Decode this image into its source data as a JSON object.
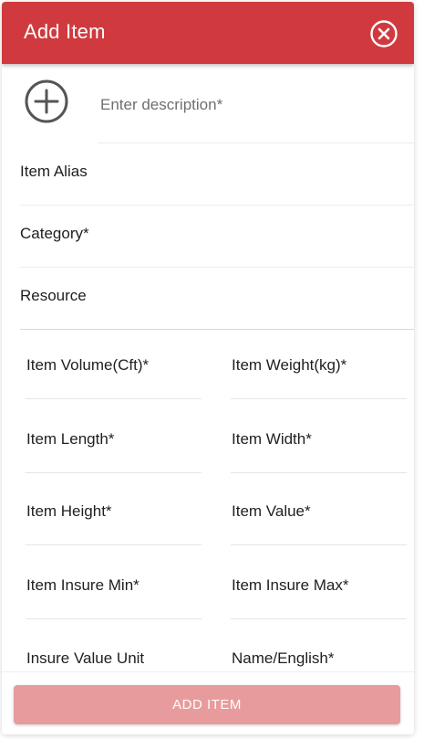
{
  "header": {
    "title": "Add Item",
    "close_icon": "close-circle-icon"
  },
  "form": {
    "add_icon": "plus-circle-icon",
    "description": {
      "placeholder": "Enter description*",
      "value": ""
    },
    "item_alias_label": "Item Alias",
    "category_label": "Category*",
    "resource_label": "Resource",
    "fields": {
      "item_volume": "Item Volume(Cft)*",
      "item_weight": "Item Weight(kg)*",
      "item_length": "Item Length*",
      "item_width": "Item Width*",
      "item_height": "Item Height*",
      "item_value": "Item Value*",
      "item_insure_min": "Item Insure Min*",
      "item_insure_max": "Item Insure Max*",
      "insure_value_unit": "Insure Value Unit",
      "name_english": "Name/English*"
    }
  },
  "footer": {
    "add_item_label": "ADD ITEM"
  },
  "colors": {
    "header_bg": "#d03a3e",
    "button_bg": "#e89b9d",
    "icon_gray": "#555555"
  }
}
